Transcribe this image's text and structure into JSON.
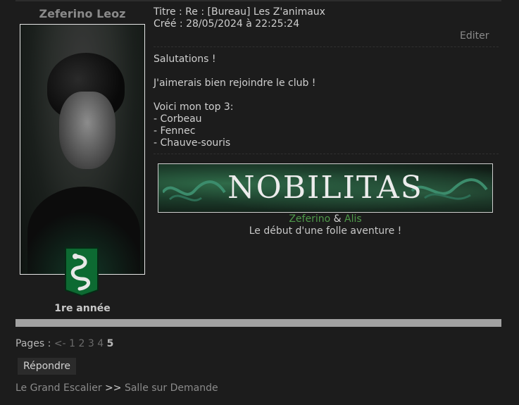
{
  "post": {
    "author": "Zeferino Leoz",
    "year": "1re année",
    "title_line": "Titre : Re : [Bureau] Les Z'animaux",
    "created_line": "Créé : 28/05/2024 à 22:25:24",
    "edit_label": "Editer",
    "content": {
      "greeting": "Salutations !",
      "line1": "J'aimerais bien rejoindre le club !",
      "top_intro": "Voici mon top 3:",
      "items": [
        "- Corbeau",
        "- Fennec",
        "- Chauve-souris"
      ]
    },
    "signature": {
      "banner_text": "NOBILITAS",
      "name1": "Zeferino",
      "amp": "&",
      "name2": "Alis",
      "tagline": "Le début d'une folle aventure !"
    }
  },
  "pagination": {
    "label": "Pages :",
    "prev": "<-",
    "pages": [
      "1",
      "2",
      "3",
      "4"
    ],
    "current": "5"
  },
  "reply_button": "Répondre",
  "breadcrumb": {
    "item1": "Le Grand Escalier",
    "separator": ">>",
    "item2": "Salle sur Demande"
  },
  "colors": {
    "background": "#1c1c1c",
    "link_green": "#4f9a4a",
    "crest_green": "#0d6a32"
  }
}
